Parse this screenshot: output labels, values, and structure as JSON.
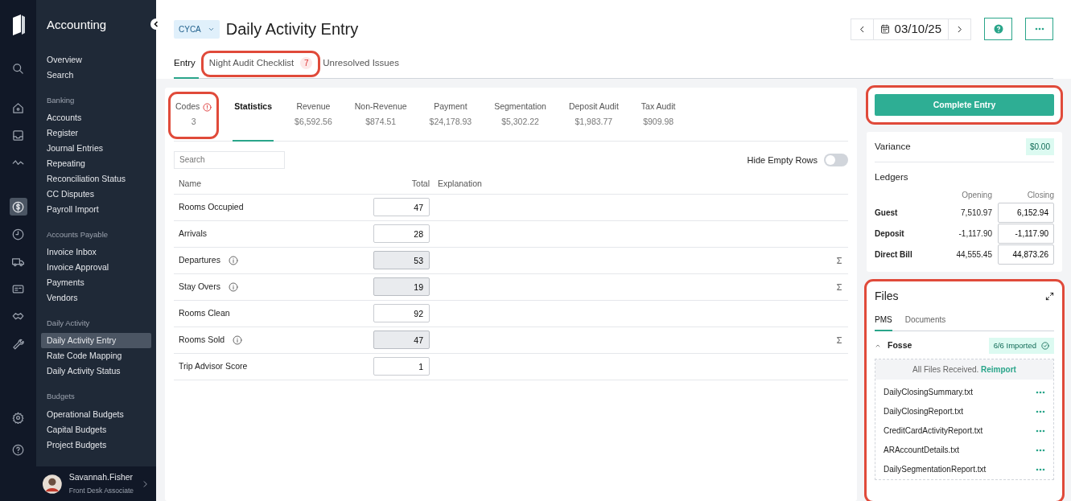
{
  "rail": {
    "icons": [
      {
        "kind": "search",
        "selected": false
      },
      {
        "kind": "home",
        "selected": false
      },
      {
        "kind": "inbox",
        "selected": false
      },
      {
        "kind": "activity",
        "selected": false
      },
      {
        "kind": "dollar",
        "selected": true
      },
      {
        "kind": "clock",
        "selected": false
      },
      {
        "kind": "truck",
        "selected": false
      },
      {
        "kind": "card",
        "selected": false
      },
      {
        "kind": "handshake",
        "selected": false
      },
      {
        "kind": "wrench",
        "selected": false
      }
    ],
    "bottom_icons": [
      {
        "kind": "settings",
        "selected": false
      },
      {
        "kind": "help",
        "selected": false
      }
    ]
  },
  "sidebar": {
    "title": "Accounting",
    "sections": [
      {
        "items": [
          {
            "label": "Overview",
            "selected": false
          },
          {
            "label": "Search",
            "selected": false
          }
        ]
      },
      {
        "heading": "Banking",
        "items": [
          {
            "label": "Accounts",
            "selected": false
          },
          {
            "label": "Register",
            "selected": false
          },
          {
            "label": "Journal Entries",
            "selected": false
          },
          {
            "label": "Repeating",
            "selected": false
          },
          {
            "label": "Reconciliation Status",
            "selected": false
          },
          {
            "label": "CC Disputes",
            "selected": false
          },
          {
            "label": "Payroll Import",
            "selected": false
          }
        ]
      },
      {
        "heading": "Accounts Payable",
        "items": [
          {
            "label": "Invoice Inbox",
            "selected": false
          },
          {
            "label": "Invoice Approval",
            "selected": false
          },
          {
            "label": "Payments",
            "selected": false
          },
          {
            "label": "Vendors",
            "selected": false
          }
        ]
      },
      {
        "heading": "Daily Activity",
        "items": [
          {
            "label": "Daily Activity Entry",
            "selected": true
          },
          {
            "label": "Rate Code Mapping",
            "selected": false
          },
          {
            "label": "Daily Activity Status",
            "selected": false
          }
        ]
      },
      {
        "heading": "Budgets",
        "items": [
          {
            "label": "Operational Budgets",
            "selected": false
          },
          {
            "label": "Capital Budgets",
            "selected": false
          },
          {
            "label": "Project Budgets",
            "selected": false
          }
        ]
      }
    ]
  },
  "user": {
    "name": "Savannah.Fisher",
    "role": "Front Desk Associate"
  },
  "header": {
    "property_code": "CYCA",
    "title": "Daily Activity Entry",
    "date": "03/10/25"
  },
  "page_tabs": [
    {
      "label": "Entry",
      "selected": true,
      "highlighted": false
    },
    {
      "label": "Night Audit Checklist",
      "badge": "7",
      "selected": false,
      "highlighted": true
    },
    {
      "label": "Unresolved Issues",
      "selected": false,
      "highlighted": false
    }
  ],
  "category_tabs": [
    {
      "label": "Codes",
      "value": "3",
      "alert": true,
      "selected": false,
      "highlighted": true
    },
    {
      "label": "Statistics",
      "selected": true,
      "alert": false,
      "highlighted": false
    },
    {
      "label": "Revenue",
      "value": "$6,592.56",
      "selected": false,
      "alert": false,
      "highlighted": false
    },
    {
      "label": "Non-Revenue",
      "value": "$874.51",
      "selected": false,
      "alert": false,
      "highlighted": false
    },
    {
      "label": "Payment",
      "value": "$24,178.93",
      "selected": false,
      "alert": false,
      "highlighted": false
    },
    {
      "label": "Segmentation",
      "value": "$5,302.22",
      "selected": false,
      "alert": false,
      "highlighted": false
    },
    {
      "label": "Deposit Audit",
      "value": "$1,983.77",
      "selected": false,
      "alert": false,
      "highlighted": false
    },
    {
      "label": "Tax Audit",
      "value": "$909.98",
      "selected": false,
      "alert": false,
      "highlighted": false
    }
  ],
  "search": {
    "placeholder": "Search"
  },
  "hide_empty_rows": {
    "label": "Hide Empty Rows",
    "on": false
  },
  "table": {
    "columns": [
      "Name",
      "Total",
      "Explanation"
    ],
    "rows": [
      {
        "name": "Rooms Occupied",
        "total": "47",
        "info": false,
        "calculated": false
      },
      {
        "name": "Arrivals",
        "total": "28",
        "info": false,
        "calculated": false
      },
      {
        "name": "Departures",
        "total": "53",
        "info": true,
        "calculated": true
      },
      {
        "name": "Stay Overs",
        "total": "19",
        "info": true,
        "calculated": true
      },
      {
        "name": "Rooms Clean",
        "total": "92",
        "info": false,
        "calculated": false
      },
      {
        "name": "Rooms Sold",
        "total": "47",
        "info": true,
        "calculated": true
      },
      {
        "name": "Trip Advisor Score",
        "total": "1",
        "info": false,
        "calculated": false
      }
    ]
  },
  "complete_button": {
    "label": "Complete Entry",
    "highlighted": true
  },
  "variance": {
    "label": "Variance",
    "value": "$0.00"
  },
  "ledgers": {
    "title": "Ledgers",
    "columns": [
      "Opening",
      "Closing"
    ],
    "rows": [
      {
        "name": "Guest",
        "opening": "7,510.97",
        "closing": "6,152.94"
      },
      {
        "name": "Deposit",
        "opening": "-1,117.90",
        "closing": "-1,117.90"
      },
      {
        "name": "Direct Bill",
        "opening": "44,555.45",
        "closing": "44,873.26"
      }
    ]
  },
  "files": {
    "title": "Files",
    "highlighted": true,
    "tabs": [
      {
        "label": "PMS",
        "selected": true
      },
      {
        "label": "Documents",
        "selected": false
      }
    ],
    "group": {
      "name": "Fosse",
      "expanded": true,
      "status": "6/6 Imported",
      "notice": "All Files Received.",
      "action": "Reimport",
      "files": [
        "DailyClosingSummary.txt",
        "DailyClosingReport.txt",
        "CreditCardActivityReport.txt",
        "ARAccountDetails.txt",
        "DailySegmentationReport.txt"
      ]
    }
  }
}
